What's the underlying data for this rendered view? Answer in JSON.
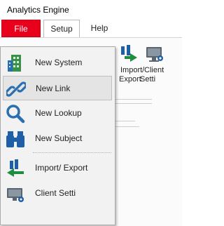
{
  "app": {
    "title": "Analytics Engine"
  },
  "tabs": [
    {
      "label": "File",
      "active": true,
      "color": "#e8001c"
    },
    {
      "label": "Setup"
    },
    {
      "label": "Help"
    }
  ],
  "ribbon": {
    "import_export_line1": "Import/",
    "import_export_line2": "Export",
    "client_settings_line1": "Client",
    "client_settings_line2": "Setti"
  },
  "menu": {
    "items": [
      {
        "label": "New System",
        "icon": "building-icon"
      },
      {
        "label": "New Link",
        "icon": "link-icon",
        "highlighted": true
      },
      {
        "label": "New Lookup",
        "icon": "magnifier-icon"
      },
      {
        "label": "New Subject",
        "icon": "binoculars-icon"
      },
      {
        "label": "Import/ Export",
        "icon": "import-export-icon"
      },
      {
        "label": "Client Setti",
        "icon": "monitor-settings-icon"
      }
    ]
  }
}
